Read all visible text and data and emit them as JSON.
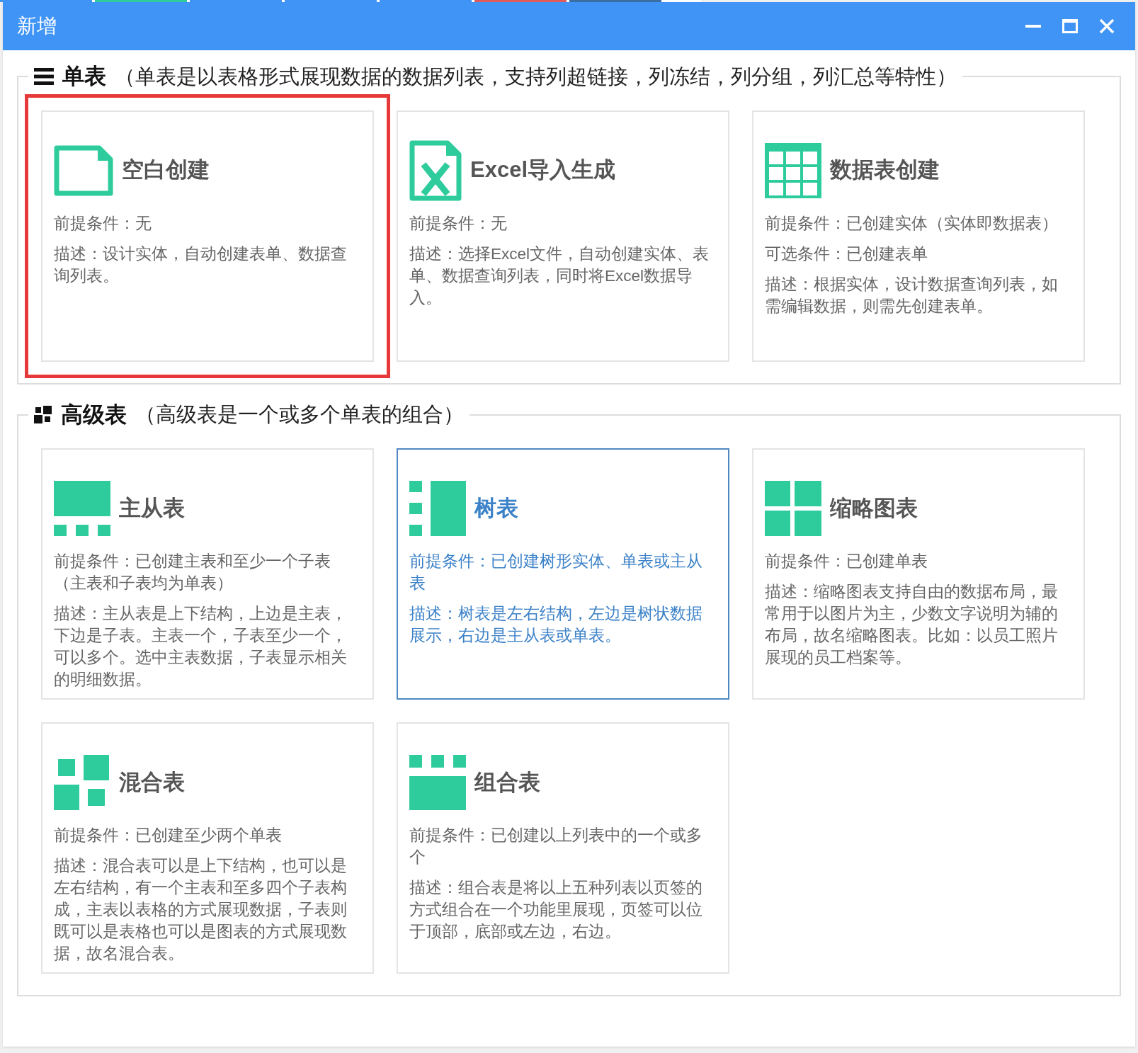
{
  "window": {
    "title": "新增"
  },
  "sections": [
    {
      "kind": "lines",
      "title": "单表",
      "description": "（单表是以表格形式展现数据的数据列表，支持列超链接，列冻结，列分组，列汇总等特性）",
      "cards": [
        {
          "kind": "blank",
          "title": "空白创建",
          "highlighted": true,
          "hovered": false,
          "paragraphs": [
            "前提条件：无",
            "描述：设计实体，自动创建表单、数据查询列表。"
          ]
        },
        {
          "kind": "excel",
          "title": "Excel导入生成",
          "highlighted": false,
          "hovered": false,
          "paragraphs": [
            "前提条件：无",
            "描述：选择Excel文件，自动创建实体、表单、数据查询列表，同时将Excel数据导入。"
          ]
        },
        {
          "kind": "grid",
          "title": "数据表创建",
          "highlighted": false,
          "hovered": false,
          "paragraphs": [
            "前提条件：已创建实体（实体即数据表）",
            "可选条件：已创建表单",
            "描述：根据实体，设计数据查询列表，如需编辑数据，则需先创建表单。"
          ]
        }
      ]
    },
    {
      "kind": "squares",
      "title": "高级表",
      "description": "（高级表是一个或多个单表的组合）",
      "cards": [
        {
          "kind": "master",
          "title": "主从表",
          "highlighted": false,
          "hovered": false,
          "paragraphs": [
            "前提条件：已创建主表和至少一个子表（主表和子表均为单表）",
            "描述：主从表是上下结构，上边是主表，下边是子表。主表一个，子表至少一个，可以多个。选中主表数据，子表显示相关的明细数据。"
          ]
        },
        {
          "kind": "tree",
          "title": "树表",
          "highlighted": false,
          "hovered": true,
          "paragraphs": [
            "前提条件：已创建树形实体、单表或主从表",
            "描述：树表是左右结构，左边是树状数据展示，右边是主从表或单表。"
          ]
        },
        {
          "kind": "thumbs",
          "title": "缩略图表",
          "highlighted": false,
          "hovered": false,
          "paragraphs": [
            "前提条件：已创建单表",
            "描述：缩略图表支持自由的数据布局，最常用于以图片为主，少数文字说明为辅的布局，故名缩略图表。比如：以员工照片展现的员工档案等。"
          ]
        },
        {
          "kind": "mixed",
          "title": "混合表",
          "highlighted": false,
          "hovered": false,
          "paragraphs": [
            "前提条件：已创建至少两个单表",
            "描述：混合表可以是上下结构，也可以是左右结构，有一个主表和至多四个子表构成，主表以表格的方式展现数据，子表则既可以是表格也可以是图表的方式展现数据，故名混合表。"
          ]
        },
        {
          "kind": "combo",
          "title": "组合表",
          "highlighted": false,
          "hovered": false,
          "paragraphs": [
            "前提条件：已创建以上列表中的一个或多个",
            "描述：组合表是将以上五种列表以页签的方式组合在一个功能里展现，页签可以位于顶部，底部或左边，右边。"
          ]
        }
      ]
    }
  ]
}
